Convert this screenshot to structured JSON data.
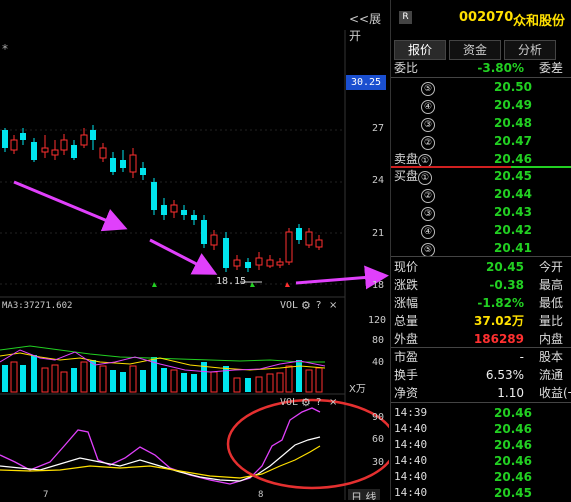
{
  "chart": {
    "expand_label": "<<展开",
    "star_label": "*",
    "price_badge": "30.25",
    "price_axis": [
      "27",
      "24",
      "21",
      "18"
    ],
    "low_label": "18.15",
    "vol_header": "MA3:37271.602",
    "vol_controls": {
      "name": "VOL",
      "q": "?",
      "x": "×"
    },
    "vol_axis": [
      "120",
      "80",
      "40"
    ],
    "vol_unit": "X万",
    "kdj_controls": {
      "name": "VOL",
      "q": "?",
      "x": "×"
    },
    "kdj_axis": [
      "90",
      "60",
      "30"
    ],
    "x_ticks": [
      "7",
      "8"
    ],
    "bottom_right": "日  线"
  },
  "header": {
    "badge": "R",
    "code": "002070",
    "name": "众和股份"
  },
  "tabs": [
    {
      "label": "报价",
      "active": true
    },
    {
      "label": "资金",
      "active": false
    },
    {
      "label": "分析",
      "active": false
    }
  ],
  "ratio": {
    "label": "委比",
    "value": "-3.80%",
    "label2": "委差"
  },
  "sell_orders": [
    {
      "level": "⑤",
      "price": "20.50"
    },
    {
      "level": "④",
      "price": "20.49"
    },
    {
      "level": "③",
      "price": "20.48"
    },
    {
      "level": "②",
      "price": "20.47"
    },
    {
      "level": "卖盘①",
      "price": "20.46"
    }
  ],
  "buy_orders": [
    {
      "level": "买盘①",
      "price": "20.45"
    },
    {
      "level": "②",
      "price": "20.44"
    },
    {
      "level": "③",
      "price": "20.43"
    },
    {
      "level": "④",
      "price": "20.42"
    },
    {
      "level": "⑤",
      "price": "20.41"
    }
  ],
  "quote": [
    {
      "label": "现价",
      "value": "20.45",
      "color": "#22d022",
      "label2": "今开"
    },
    {
      "label": "涨跌",
      "value": "-0.38",
      "color": "#22d022",
      "label2": "最高"
    },
    {
      "label": "涨幅",
      "value": "-1.82%",
      "color": "#22d022",
      "label2": "最低"
    },
    {
      "label": "总量",
      "value": "37.02万",
      "color": "#ffe000",
      "label2": "量比"
    },
    {
      "label": "外盘",
      "value": "186289",
      "color": "#ff3030",
      "label2": "内盘"
    }
  ],
  "fundamentals": [
    {
      "label": "市盈",
      "value": "-",
      "label2": "股本"
    },
    {
      "label": "换手",
      "value": "6.53%",
      "label2": "流通"
    },
    {
      "label": "净资",
      "value": "1.10",
      "label2": "收益(一"
    }
  ],
  "ticks": [
    {
      "time": "14:39",
      "price": "20.46"
    },
    {
      "time": "14:40",
      "price": "20.46"
    },
    {
      "time": "14:40",
      "price": "20.46"
    },
    {
      "time": "14:40",
      "price": "20.46"
    },
    {
      "time": "14:40",
      "price": "20.46"
    },
    {
      "time": "14:40",
      "price": "20.45"
    }
  ],
  "colors": {
    "up": "#ff3030",
    "down": "#00e5ee",
    "annotation": "#e040fb",
    "circle": "#e53030",
    "ma": "#ffe000"
  }
}
